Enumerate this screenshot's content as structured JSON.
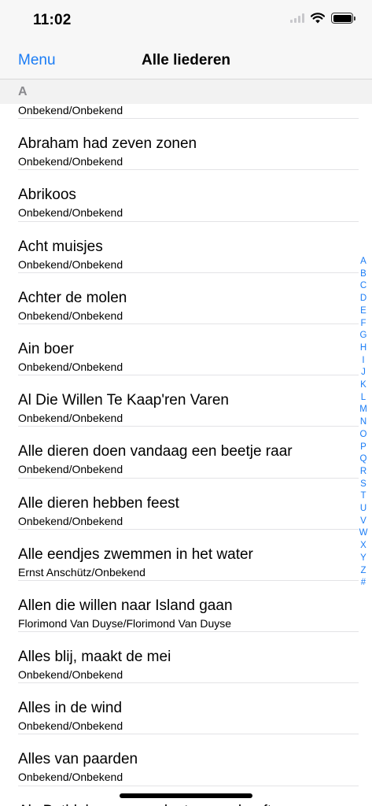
{
  "status_bar": {
    "time": "11:02"
  },
  "nav": {
    "back_label": "Menu",
    "title": "Alle liederen"
  },
  "section": {
    "letter": "A"
  },
  "songs": [
    {
      "title": "",
      "subtitle": "Onbekend/Onbekend"
    },
    {
      "title": "Abraham had zeven zonen",
      "subtitle": "Onbekend/Onbekend"
    },
    {
      "title": "Abrikoos",
      "subtitle": "Onbekend/Onbekend"
    },
    {
      "title": "Acht muisjes",
      "subtitle": "Onbekend/Onbekend"
    },
    {
      "title": "Achter de molen",
      "subtitle": "Onbekend/Onbekend"
    },
    {
      "title": "Ain boer",
      "subtitle": "Onbekend/Onbekend"
    },
    {
      "title": "Al Die Willen Te Kaap'ren Varen",
      "subtitle": "Onbekend/Onbekend"
    },
    {
      "title": "Alle dieren doen vandaag een beetje raar",
      "subtitle": "Onbekend/Onbekend"
    },
    {
      "title": "Alle dieren hebben feest",
      "subtitle": "Onbekend/Onbekend"
    },
    {
      "title": "Alle eendjes zwemmen in het water",
      "subtitle": "Ernst Anschütz/Onbekend"
    },
    {
      "title": "Allen die willen naar Island gaan",
      "subtitle": "Florimond Van Duyse/Florimond Van Duyse"
    },
    {
      "title": "Alles blij, maakt de mei",
      "subtitle": "Onbekend/Onbekend"
    },
    {
      "title": "Alles in de wind",
      "subtitle": "Onbekend/Onbekend"
    },
    {
      "title": "Alles van paarden",
      "subtitle": "Onbekend/Onbekend"
    },
    {
      "title": "Als Bethlehem geen plaats meer heeft",
      "subtitle": ""
    }
  ],
  "index_letters": [
    "A",
    "B",
    "C",
    "D",
    "E",
    "F",
    "G",
    "H",
    "I",
    "J",
    "K",
    "L",
    "M",
    "N",
    "O",
    "P",
    "Q",
    "R",
    "S",
    "T",
    "U",
    "V",
    "W",
    "X",
    "Y",
    "Z",
    "#"
  ],
  "colors": {
    "accent": "#1a7cf5",
    "section_header_text": "#8a8a8e"
  },
  "icons": {
    "signal": "cellular-signal-icon",
    "wifi": "wifi-icon",
    "battery": "battery-icon"
  }
}
